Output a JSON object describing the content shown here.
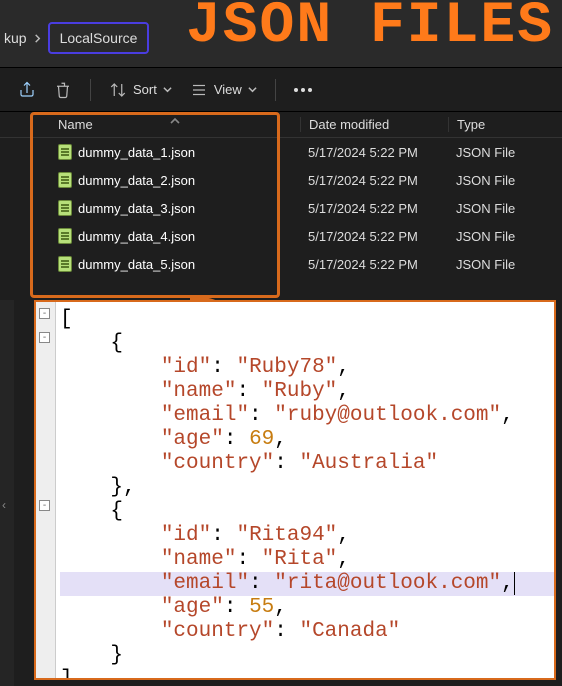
{
  "annotation_title": "JSON FILES",
  "breadcrumbs": {
    "parent": "kup",
    "current": "LocalSource"
  },
  "toolbar": {
    "sort_label": "Sort",
    "view_label": "View"
  },
  "columns": {
    "name": "Name",
    "date": "Date modified",
    "type": "Type"
  },
  "files": [
    {
      "name": "dummy_data_1.json",
      "date": "5/17/2024 5:22 PM",
      "type": "JSON File"
    },
    {
      "name": "dummy_data_2.json",
      "date": "5/17/2024 5:22 PM",
      "type": "JSON File"
    },
    {
      "name": "dummy_data_3.json",
      "date": "5/17/2024 5:22 PM",
      "type": "JSON File"
    },
    {
      "name": "dummy_data_4.json",
      "date": "5/17/2024 5:22 PM",
      "type": "JSON File"
    },
    {
      "name": "dummy_data_5.json",
      "date": "5/17/2024 5:22 PM",
      "type": "JSON File"
    }
  ],
  "editor": {
    "records": [
      {
        "id": "Ruby78",
        "name": "Ruby",
        "email": "ruby@outlook.com",
        "age": 69,
        "country": "Australia"
      },
      {
        "id": "Rita94",
        "name": "Rita",
        "email": "rita@outlook.com",
        "age": 55,
        "country": "Canada"
      }
    ],
    "highlighted_line_index": 11
  }
}
